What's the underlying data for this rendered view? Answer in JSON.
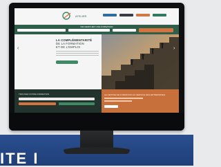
{
  "banner": {
    "text": "ITE I"
  },
  "site": {
    "logo_text": "ATELIER",
    "search_title": "RECHERCHER UNE FORMATION",
    "hero": {
      "title_line1": "LA COMPLÉMENTARITÉ",
      "title_line2": "DE LA FORMATION",
      "title_line3": "ET DE L'EMPLOI",
      "arrow_left": "‹",
      "arrow_right": "›"
    },
    "bottom_left": {
      "label": "TROUVEZ VOTRE FORMATION"
    },
    "bottom_right": {
      "label": "LE CENTRE DE FORMATION AU SERVICE DES ENTREPRISES"
    }
  },
  "colors": {
    "brand_green": "#2f5e4b",
    "accent_orange": "#d4733d",
    "banner_blue": "#2a4e8f"
  }
}
